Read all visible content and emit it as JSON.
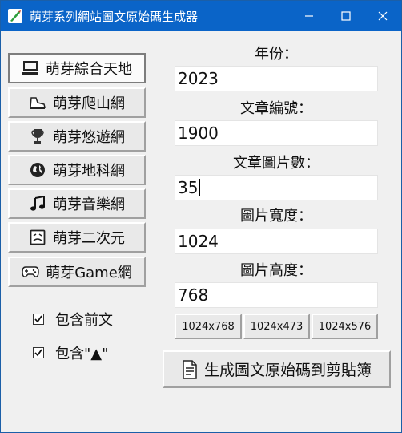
{
  "window": {
    "title": "萌芽系列網站圖文原始碼生成器"
  },
  "nav": [
    {
      "label": "萌芽綜合天地",
      "icon": "computer-icon"
    },
    {
      "label": "萌芽爬山網",
      "icon": "hiking-shoe-icon"
    },
    {
      "label": "萌芽悠遊網",
      "icon": "trophy-icon"
    },
    {
      "label": "萌芽地科網",
      "icon": "globe-icon"
    },
    {
      "label": "萌芽音樂網",
      "icon": "music-note-icon"
    },
    {
      "label": "萌芽二次元",
      "icon": "anime-face-icon"
    },
    {
      "label": "萌芽Game網",
      "icon": "gamepad-icon"
    }
  ],
  "options": {
    "include_preface": {
      "label": "包含前文",
      "checked": true
    },
    "include_triangle": {
      "label": "包含\"▲\"",
      "checked": true
    }
  },
  "fields": {
    "year": {
      "label": "年份：",
      "value": "2023"
    },
    "article_no": {
      "label": "文章編號：",
      "value": "1900"
    },
    "image_count": {
      "label": "文章圖片數：",
      "value": "35"
    },
    "image_width": {
      "label": "圖片寬度：",
      "value": "1024"
    },
    "image_height": {
      "label": "圖片高度：",
      "value": "768"
    }
  },
  "presets": [
    "1024x768",
    "1024x473",
    "1024x576"
  ],
  "generate_label": "生成圖文原始碼到剪貼簿",
  "colors": {
    "titlebar": "#0a64c8",
    "window_bg": "#f0f0f0"
  }
}
